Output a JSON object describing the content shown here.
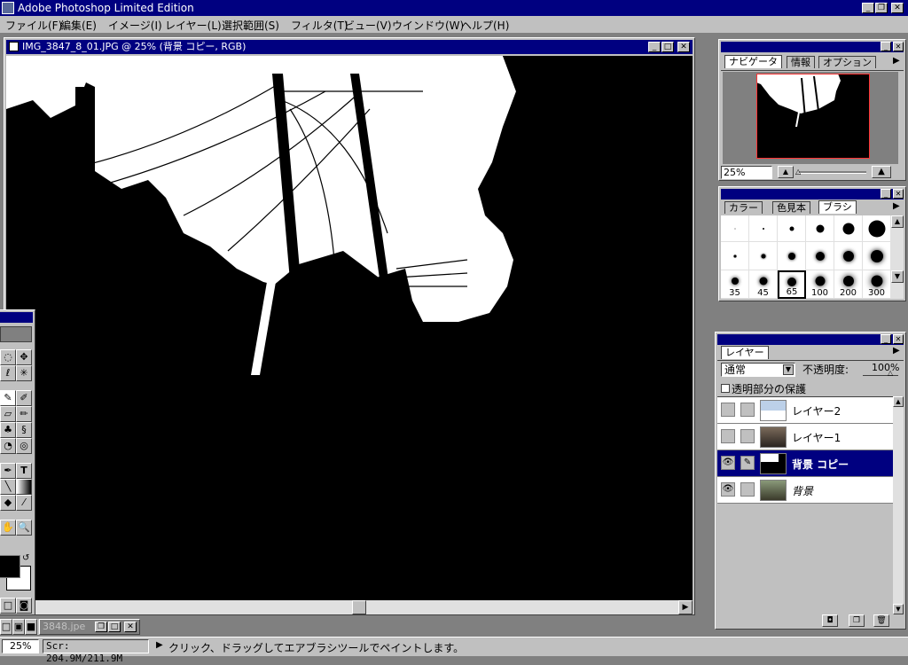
{
  "app": {
    "title": "Adobe Photoshop Limited Edition"
  },
  "menu": [
    "ファイル(F)",
    "編集(E)",
    "イメージ(I)",
    "レイヤー(L)",
    "選択範囲(S)",
    "フィルタ(T)",
    "ビュー(V)",
    "ウインドウ(W)",
    "ヘルプ(H)"
  ],
  "document": {
    "title": "IMG_3847_8_01.JPG @ 25% (背景 コピー, RGB)"
  },
  "minimized_doc": {
    "title": "3848.jpe"
  },
  "navigator": {
    "tabs": [
      "ナビゲータ",
      "情報",
      "オプション"
    ],
    "zoom": "25%"
  },
  "brushes": {
    "tabs": [
      "カラー",
      "色見本",
      "ブラシ"
    ],
    "labels": [
      "35",
      "45",
      "65",
      "100",
      "200",
      "300"
    ]
  },
  "layers": {
    "tab": "レイヤー",
    "mode": "通常",
    "opacity_label": "不透明度:",
    "opacity_value": "100%",
    "preserve_label": "透明部分の保護",
    "items": [
      {
        "name": "レイヤー2",
        "visible": false,
        "selected": false
      },
      {
        "name": "レイヤー1",
        "visible": false,
        "selected": false
      },
      {
        "name": "背景 コピー",
        "visible": true,
        "selected": true
      },
      {
        "name": "背景",
        "visible": true,
        "selected": false
      }
    ]
  },
  "status": {
    "zoom": "25%",
    "scratch": "Scr: 204.9M/211.9M",
    "message": "クリック、ドラッグしてエアブラシツールでペイントします。"
  },
  "colors": {
    "title_active": "#000080",
    "desktop": "#808080",
    "face": "#c0c0c0"
  }
}
